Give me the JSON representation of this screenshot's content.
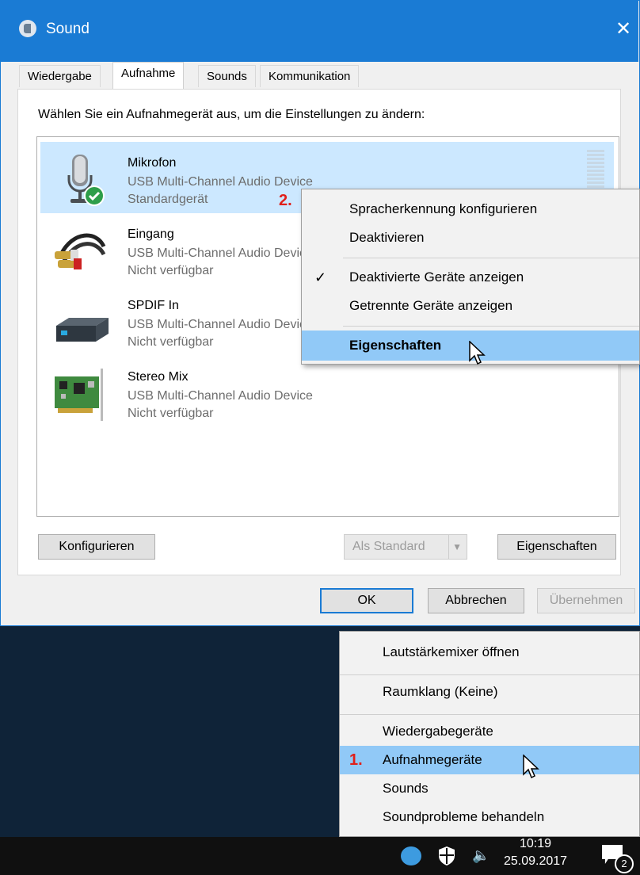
{
  "window": {
    "title": "Sound",
    "close_glyph": "✕",
    "tabs": [
      "Wiedergabe",
      "Aufnahme",
      "Sounds",
      "Kommunikation"
    ],
    "instruction": "Wählen Sie ein Aufnahmegerät aus, um die Einstellungen zu ändern:",
    "devices": [
      {
        "name": "Mikrofon",
        "description": "USB Multi-Channel Audio Device",
        "status": "Standardgerät",
        "icon": "microphone-icon"
      },
      {
        "name": "Eingang",
        "description": "USB Multi-Channel Audio Device",
        "status": "Nicht verfügbar",
        "icon": "rca-cable-icon"
      },
      {
        "name": "SPDIF In",
        "description": "USB Multi-Channel Audio Device",
        "status": "Nicht verfügbar",
        "icon": "spdif-device-icon"
      },
      {
        "name": "Stereo Mix",
        "description": "USB Multi-Channel Audio Device",
        "status": "Nicht verfügbar",
        "icon": "sound-card-icon"
      }
    ],
    "buttons": {
      "configure": "Konfigurieren",
      "set_default": "Als Standard",
      "properties": "Eigenschaften",
      "ok": "OK",
      "cancel": "Abbrechen",
      "apply": "Übernehmen"
    }
  },
  "device_context_menu": {
    "items": [
      "Spracherkennung konfigurieren",
      "Deaktivieren",
      "Deaktivierte Geräte anzeigen",
      "Getrennte Geräte anzeigen",
      "Eigenschaften"
    ],
    "checkmark": "✓"
  },
  "tray_context_menu": {
    "items": [
      "Lautstärkemixer öffnen",
      "Raumklang (Keine)",
      "Wiedergabegeräte",
      "Aufnahmegeräte",
      "Sounds",
      "Soundprobleme behandeln"
    ]
  },
  "annotations": {
    "step1": "1.",
    "step2": "2."
  },
  "taskbar": {
    "time": "10:19",
    "date": "25.09.2017",
    "notification_count": "2"
  },
  "colors": {
    "accent": "#1a7bd4",
    "highlight": "#91c9f7",
    "selection": "#cce8ff",
    "annotation": "#e0201b"
  }
}
